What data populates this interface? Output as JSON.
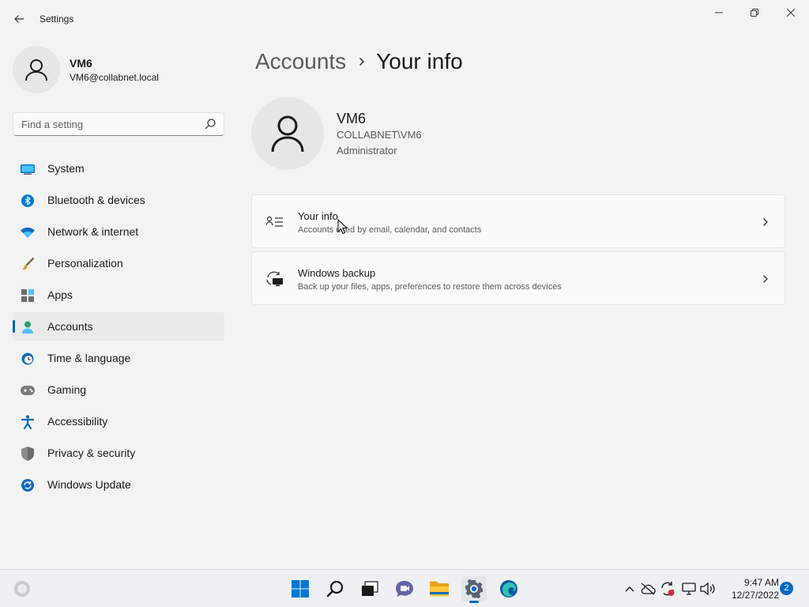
{
  "window": {
    "title": "Settings"
  },
  "user": {
    "name": "VM6",
    "email": "VM6@collabnet.local"
  },
  "search": {
    "placeholder": "Find a setting"
  },
  "sidebar": {
    "items": [
      {
        "label": "System",
        "icon": "monitor-icon",
        "active": false
      },
      {
        "label": "Bluetooth & devices",
        "icon": "bluetooth-icon",
        "active": false
      },
      {
        "label": "Network & internet",
        "icon": "wifi-icon",
        "active": false
      },
      {
        "label": "Personalization",
        "icon": "paintbrush-icon",
        "active": false
      },
      {
        "label": "Apps",
        "icon": "apps-icon",
        "active": false
      },
      {
        "label": "Accounts",
        "icon": "person-icon",
        "active": true
      },
      {
        "label": "Time & language",
        "icon": "globe-clock-icon",
        "active": false
      },
      {
        "label": "Gaming",
        "icon": "gamepad-icon",
        "active": false
      },
      {
        "label": "Accessibility",
        "icon": "accessibility-icon",
        "active": false
      },
      {
        "label": "Privacy & security",
        "icon": "shield-icon",
        "active": false
      },
      {
        "label": "Windows Update",
        "icon": "sync-icon",
        "active": false
      }
    ]
  },
  "breadcrumb": {
    "parent": "Accounts",
    "current": "Your info"
  },
  "profile": {
    "name": "VM6",
    "domain": "COLLABNET\\VM6",
    "role": "Administrator"
  },
  "cards": [
    {
      "title": "Your info",
      "description": "Accounts used by email, calendar, and contacts",
      "icon": "contact-card-icon"
    },
    {
      "title": "Windows backup",
      "description": "Back up your files, apps, preferences to restore them across devices",
      "icon": "backup-icon"
    }
  ],
  "taskbar": {
    "apps": [
      "start-icon",
      "search-icon",
      "task-view-icon",
      "chat-icon",
      "file-explorer-icon",
      "settings-icon",
      "edge-icon"
    ],
    "active_app": "settings-icon",
    "time": "9:47 AM",
    "date": "12/27/2022",
    "notifications": "2"
  },
  "colors": {
    "accent": "#005fb8",
    "background": "#f3f3f3",
    "card": "#fbfbfb"
  }
}
